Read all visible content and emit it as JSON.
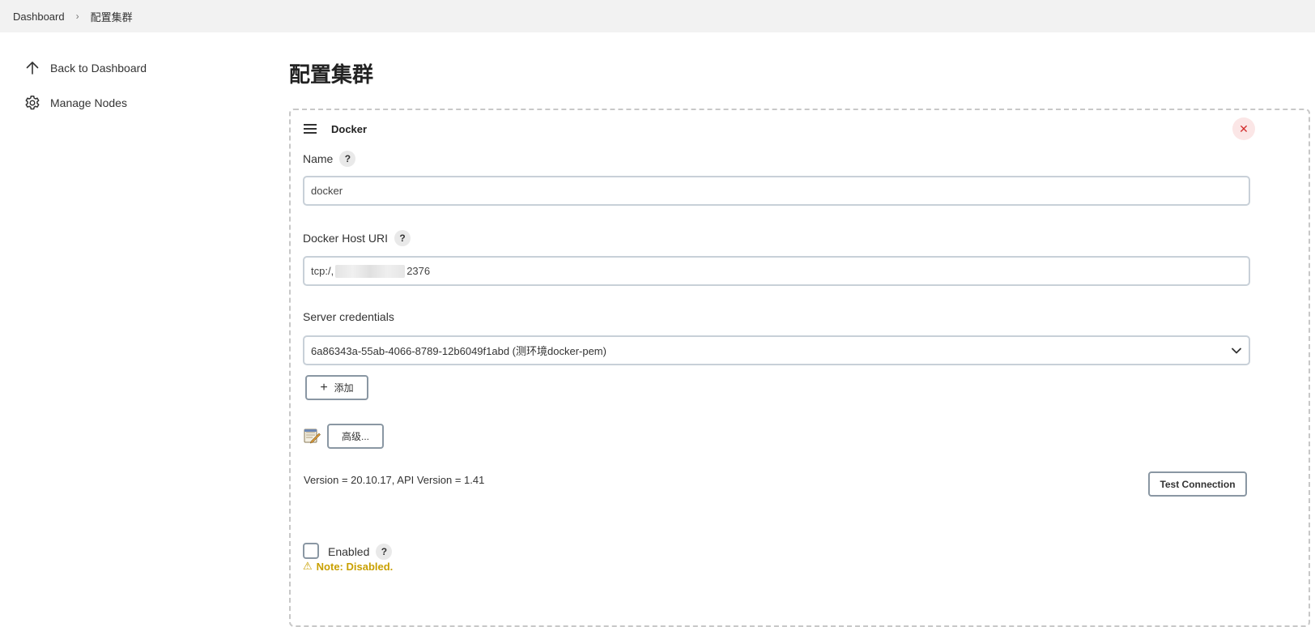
{
  "breadcrumb": {
    "items": [
      "Dashboard",
      "配置集群"
    ],
    "separator": "›"
  },
  "sidebar": {
    "items": [
      {
        "label": "Back to Dashboard",
        "icon": "arrow-up-icon"
      },
      {
        "label": "Manage Nodes",
        "icon": "gear-icon"
      }
    ]
  },
  "page": {
    "title": "配置集群"
  },
  "cloud": {
    "title": "Docker",
    "delete_symbol": "✕",
    "name_label": "Name",
    "name_value": "docker",
    "host_label": "Docker Host URI",
    "host_value_prefix": "tcp:/,",
    "host_value_suffix": "2376",
    "credentials_label": "Server credentials",
    "credentials_value": "6a86343a-55ab-4066-8789-12b6049f1abd (测环境docker-pem)",
    "add_label": "添加",
    "advanced_label": "高级...",
    "version_text": "Version = 20.10.17, API Version = 1.41",
    "test_connection_label": "Test Connection",
    "enabled_label": "Enabled",
    "enabled_checked": false,
    "note_text": "Note: Disabled.",
    "help_symbol": "?"
  },
  "colors": {
    "breadcrumb_bg": "#f2f2f2",
    "warning": "#c9a000",
    "delete": "#d32f2f"
  }
}
